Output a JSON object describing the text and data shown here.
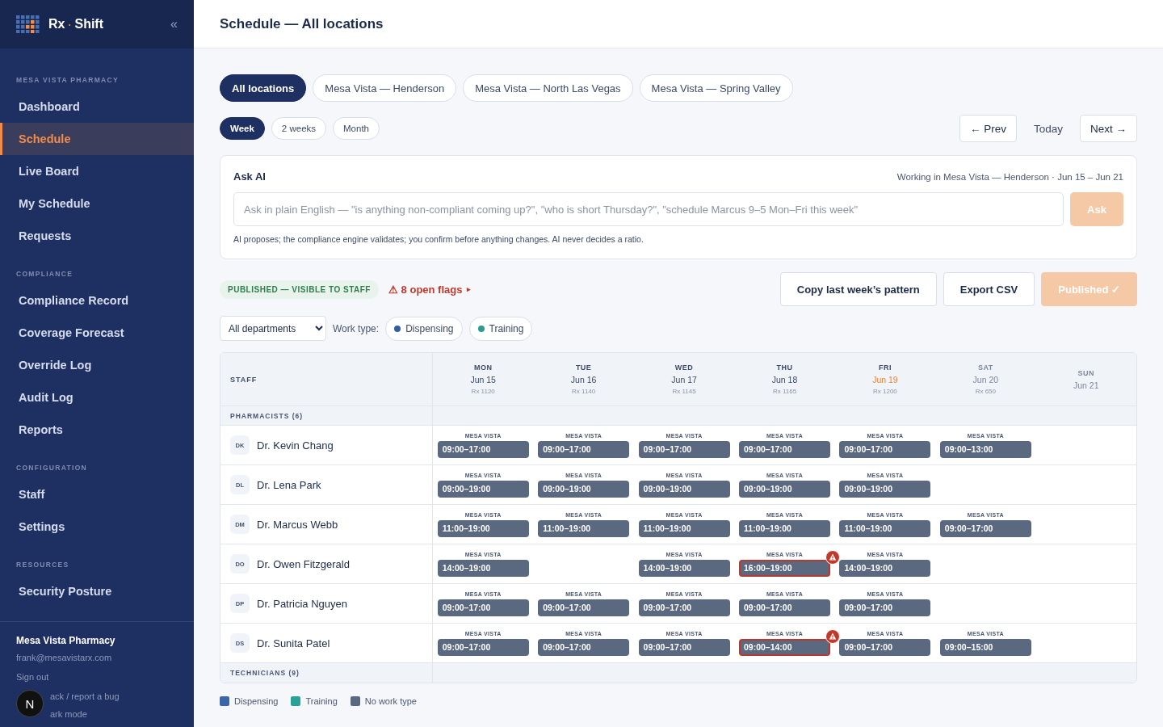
{
  "brand": {
    "name_a": "Rx",
    "sep": "·",
    "name_b": "Shift",
    "collapse": "«"
  },
  "sidebar": {
    "sections": [
      {
        "heading": "MESA VISTA PHARMACY",
        "items": [
          {
            "label": "Dashboard",
            "selected": false
          },
          {
            "label": "Schedule",
            "selected": true
          },
          {
            "label": "Live Board",
            "selected": false
          },
          {
            "label": "My Schedule",
            "selected": false
          },
          {
            "label": "Requests",
            "selected": false
          }
        ]
      },
      {
        "heading": "COMPLIANCE",
        "items": [
          {
            "label": "Compliance Record",
            "selected": false
          },
          {
            "label": "Coverage Forecast",
            "selected": false
          },
          {
            "label": "Override Log",
            "selected": false
          },
          {
            "label": "Audit Log",
            "selected": false
          },
          {
            "label": "Reports",
            "selected": false
          }
        ]
      },
      {
        "heading": "CONFIGURATION",
        "items": [
          {
            "label": "Staff",
            "selected": false
          },
          {
            "label": "Settings",
            "selected": false
          }
        ]
      },
      {
        "heading": "RESOURCES",
        "items": [
          {
            "label": "Security Posture",
            "selected": false
          }
        ]
      }
    ],
    "account": {
      "org": "Mesa Vista Pharmacy",
      "email": "frank@mesavistarx.com",
      "sign_out": "Sign out",
      "feedback": "ack / report a bug",
      "dark_mode": "ark mode",
      "dev_badge": "N"
    }
  },
  "page_title": "Schedule — All locations",
  "location_tabs": [
    {
      "label": "All locations",
      "selected": true
    },
    {
      "label": "Mesa Vista — Henderson",
      "selected": false
    },
    {
      "label": "Mesa Vista — North Las Vegas",
      "selected": false
    },
    {
      "label": "Mesa Vista — Spring Valley",
      "selected": false
    }
  ],
  "range_tabs": [
    {
      "label": "Week",
      "selected": true
    },
    {
      "label": "2 weeks",
      "selected": false
    },
    {
      "label": "Month",
      "selected": false
    }
  ],
  "nav": {
    "prev": "← Prev",
    "today": "Today",
    "next": "Next →"
  },
  "ask_ai": {
    "title": "Ask AI",
    "context": "Working in Mesa Vista — Henderson · Jun 15 – Jun 21",
    "placeholder": "Ask in plain English — \"is anything non-compliant coming up?\", \"who is short Thursday?\", \"schedule Marcus 9–5 Mon–Fri this week\"",
    "button": "Ask",
    "note": "AI proposes; the compliance engine validates; you confirm before anything changes. AI never decides a ratio."
  },
  "status": {
    "badge": "PUBLISHED — VISIBLE TO STAFF",
    "flags": "⚠ 8 open flags",
    "flags_caret": "▸"
  },
  "actions": [
    {
      "label": "Copy last week’s pattern",
      "kind": "outline"
    },
    {
      "label": "Export CSV",
      "kind": "outline"
    },
    {
      "label": "Published ✓",
      "kind": "primary"
    }
  ],
  "filters": {
    "department": "All departments",
    "work_type_label": "Work type:",
    "work_types": [
      {
        "label": "Dispensing",
        "color": "#2f5f9e"
      },
      {
        "label": "Training",
        "color": "#2a9d8f"
      }
    ]
  },
  "table": {
    "staff_header": "STAFF",
    "days": [
      {
        "dow": "MON",
        "date": "Jun 15",
        "rx": "Rx 1120",
        "today": false,
        "weekend": false
      },
      {
        "dow": "TUE",
        "date": "Jun 16",
        "rx": "Rx 1140",
        "today": false,
        "weekend": false
      },
      {
        "dow": "WED",
        "date": "Jun 17",
        "rx": "Rx 1145",
        "today": false,
        "weekend": false
      },
      {
        "dow": "THU",
        "date": "Jun 18",
        "rx": "Rx 1165",
        "today": false,
        "weekend": false
      },
      {
        "dow": "FRI",
        "date": "Jun 19",
        "rx": "Rx 1200",
        "today": true,
        "weekend": false
      },
      {
        "dow": "SAT",
        "date": "Jun 20",
        "rx": "Rx 650",
        "today": false,
        "weekend": true
      },
      {
        "dow": "SUN",
        "date": "Jun 21",
        "today": false,
        "weekend": true
      }
    ],
    "groups": [
      {
        "label": "PHARMACISTS (6)",
        "staff": [
          {
            "initials": "DK",
            "name": "Dr. Kevin Chang",
            "shifts": [
              {
                "site": "MESA VISTA",
                "time": "09:00–17:00",
                "flagged": false
              },
              {
                "site": "MESA VISTA",
                "time": "09:00–17:00",
                "flagged": false
              },
              {
                "site": "MESA VISTA",
                "time": "09:00–17:00",
                "flagged": false
              },
              {
                "site": "MESA VISTA",
                "time": "09:00–17:00",
                "flagged": false
              },
              {
                "site": "MESA VISTA",
                "time": "09:00–17:00",
                "flagged": false
              },
              {
                "site": "MESA VISTA",
                "time": "09:00–13:00",
                "flagged": false
              },
              {
                "kind": "off"
              }
            ]
          },
          {
            "initials": "DL",
            "name": "Dr. Lena Park",
            "shifts": [
              {
                "site": "MESA VISTA",
                "time": "09:00–19:00",
                "flagged": false
              },
              {
                "site": "MESA VISTA",
                "time": "09:00–19:00",
                "flagged": false
              },
              {
                "site": "MESA VISTA",
                "time": "09:00–19:00",
                "flagged": false
              },
              {
                "site": "MESA VISTA",
                "time": "09:00–19:00",
                "flagged": false
              },
              {
                "site": "MESA VISTA",
                "time": "09:00–19:00",
                "flagged": false
              },
              {
                "kind": "off"
              },
              {
                "kind": "off"
              }
            ]
          },
          {
            "initials": "DM",
            "name": "Dr. Marcus Webb",
            "shifts": [
              {
                "site": "MESA VISTA",
                "time": "11:00–19:00",
                "flagged": false
              },
              {
                "site": "MESA VISTA",
                "time": "11:00–19:00",
                "flagged": false
              },
              {
                "site": "MESA VISTA",
                "time": "11:00–19:00",
                "flagged": false
              },
              {
                "site": "MESA VISTA",
                "time": "11:00–19:00",
                "flagged": false
              },
              {
                "site": "MESA VISTA",
                "time": "11:00–19:00",
                "flagged": false
              },
              {
                "site": "MESA VISTA",
                "time": "09:00–17:00",
                "flagged": false
              },
              {
                "kind": "off"
              }
            ]
          },
          {
            "initials": "DO",
            "name": "Dr. Owen Fitzgerald",
            "shifts": [
              {
                "site": "MESA VISTA",
                "time": "14:00–19:00",
                "flagged": false
              },
              {
                "kind": "off"
              },
              {
                "site": "MESA VISTA",
                "time": "14:00–19:00",
                "flagged": false
              },
              {
                "site": "MESA VISTA",
                "time": "16:00–19:00",
                "flagged": true
              },
              {
                "site": "MESA VISTA",
                "time": "14:00–19:00",
                "flagged": false
              },
              {
                "kind": "off"
              },
              {
                "kind": "off"
              }
            ]
          },
          {
            "initials": "DP",
            "name": "Dr. Patricia Nguyen",
            "shifts": [
              {
                "site": "MESA VISTA",
                "time": "09:00–17:00",
                "flagged": false
              },
              {
                "site": "MESA VISTA",
                "time": "09:00–17:00",
                "flagged": false
              },
              {
                "site": "MESA VISTA",
                "time": "09:00–17:00",
                "flagged": false
              },
              {
                "site": "MESA VISTA",
                "time": "09:00–17:00",
                "flagged": false
              },
              {
                "site": "MESA VISTA",
                "time": "09:00–17:00",
                "flagged": false
              },
              {
                "kind": "off"
              },
              {
                "kind": "off"
              }
            ]
          },
          {
            "initials": "DS",
            "name": "Dr. Sunita Patel",
            "shifts": [
              {
                "site": "MESA VISTA",
                "time": "09:00–17:00",
                "flagged": false
              },
              {
                "site": "MESA VISTA",
                "time": "09:00–17:00",
                "flagged": false
              },
              {
                "site": "MESA VISTA",
                "time": "09:00–17:00",
                "flagged": false
              },
              {
                "site": "MESA VISTA",
                "time": "09:00–14:00",
                "flagged": true
              },
              {
                "site": "MESA VISTA",
                "time": "09:00–17:00",
                "flagged": false
              },
              {
                "site": "MESA VISTA",
                "time": "09:00–15:00",
                "flagged": false
              },
              {
                "kind": "off"
              }
            ]
          }
        ]
      },
      {
        "label": "TECHNICIANS (9)"
      }
    ]
  },
  "legend": [
    {
      "label": "Dispensing",
      "color": "#3b66a8"
    },
    {
      "label": "Training",
      "color": "#2aa198"
    },
    {
      "label": "No work type",
      "color": "#5a6880"
    }
  ]
}
